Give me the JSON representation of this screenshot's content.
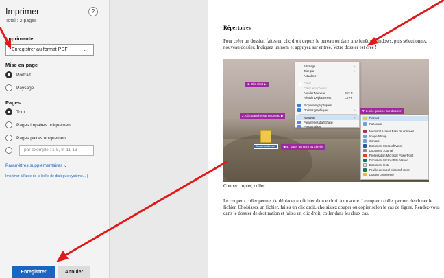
{
  "panel": {
    "title": "Imprimer",
    "subtitle": "Total : 2 pages",
    "help_label": "?",
    "printer": {
      "label": "Imprimante",
      "value": "Enregistrer au format PDF"
    },
    "layout": {
      "label": "Mise en page",
      "options": [
        "Portrait",
        "Paysage"
      ],
      "selected": "Portrait"
    },
    "pages": {
      "label": "Pages",
      "options": [
        "Tout",
        "Pages impaires uniquement",
        "Pages paires uniquement"
      ],
      "selected": "Tout",
      "range_placeholder": "par exemple : 1-5, 8, 11-13"
    },
    "more_settings": "Paramètres supplémentaires ⌄",
    "system_dialog": "Imprimer à l'aide de la boîte de dialogue système... (",
    "save_label": "Enregistrer",
    "cancel_label": "Annuler"
  },
  "preview": {
    "heading": "Répertoires",
    "paragraph1": "Pour créer un dossier, faites un clic droit depuis le bureau ou dans une fenêtre Windows, puis sélectionnez nouveau dossier. Indiquez un nom et appuyez sur entrée. Votre dossier est crée !",
    "caption": "Couper, copier, coller",
    "paragraph2": "Le couper / coller permet de déplacer un fichier d'un endroit à un autre. Le copier / coller permet de cloner le fichier. Choisissez un fichier, faites un clic droit, choisissez couper ou copier selon le cas de figure. Rendez-vous dans le dossier de destination et faites un clic droit, coller dans les deux cas.",
    "figure": {
      "tags": [
        "1. Clic droit ▶",
        "2. Clic gauche sur nouveau ▶",
        "▼ 3. clic gauche sur dossier",
        "◀ 4. Taper un nom au clavier"
      ],
      "folder_name": "Nouveau dossier",
      "menu1": {
        "items": [
          "Affichage",
          "Trier par",
          "Actualiser",
          "Coller",
          "Coller le raccourci",
          "Annuler Nouveau",
          "Rétablir Déplacement",
          "Propriétés graphiques...",
          "Options graphiques",
          "Nouveau",
          "Paramètres d'affichage",
          "Personnaliser"
        ],
        "shortcuts": [
          "Ctrl+Z",
          "Ctrl+Y"
        ]
      },
      "menu2": {
        "items": [
          "Dossier",
          "Raccourci",
          "Microsoft Access Base de données",
          "Image bitmap",
          "Contact",
          "Document Microsoft Word",
          "Document Journal",
          "Présentation Microsoft PowerPoint",
          "Document Microsoft Publisher",
          "Document texte",
          "Feuille de calcul Microsoft Excel",
          "Dossier compressé"
        ]
      }
    }
  },
  "colors": {
    "accent": "#1a66c2",
    "arrow": "#e0191b",
    "tag": "#9b2b9b"
  }
}
